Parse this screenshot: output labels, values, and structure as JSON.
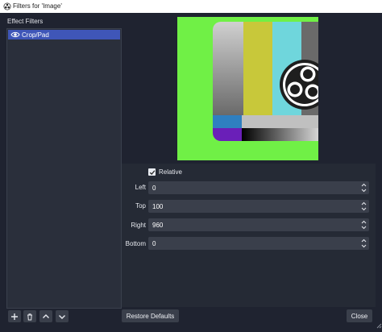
{
  "window": {
    "title": "Filters for 'Image'"
  },
  "effect_filters": {
    "label": "Effect Filters",
    "items": [
      {
        "label": "Crop/Pad",
        "selected": true
      }
    ]
  },
  "crop_pad": {
    "relative": {
      "label": "Relative",
      "checked": true
    },
    "fields": [
      {
        "label": "Left",
        "value": "0"
      },
      {
        "label": "Top",
        "value": "100"
      },
      {
        "label": "Right",
        "value": "960"
      },
      {
        "label": "Bottom",
        "value": "0"
      }
    ]
  },
  "buttons": {
    "restore_defaults": "Restore Defaults",
    "close": "Close"
  },
  "toolbar_icons": [
    "add-icon",
    "trash-icon",
    "move-up-icon",
    "move-down-icon"
  ],
  "colors": {
    "window_bg": "#1f2330",
    "panel_bg": "#2a2f3b",
    "selection": "#3f56b8",
    "field_bg": "#3a3f4b",
    "preview_green": "#70f046"
  }
}
